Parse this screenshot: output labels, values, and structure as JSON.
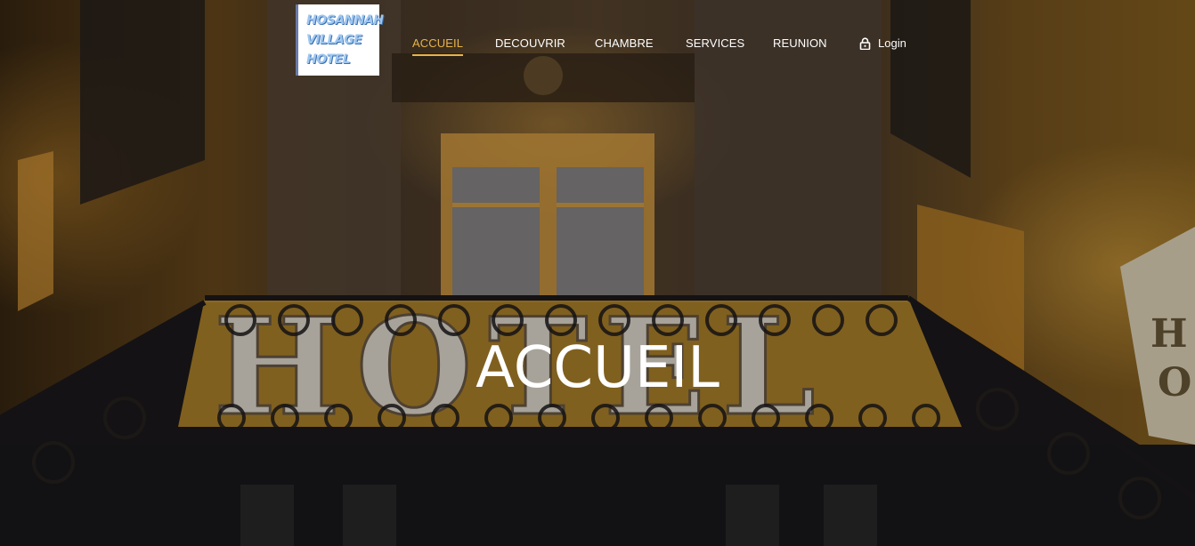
{
  "logo": {
    "lines": [
      "HOSANNAH",
      "VILLAGE",
      "HOTEL"
    ]
  },
  "nav": {
    "items": [
      {
        "label": "ACCUEIL",
        "active": true
      },
      {
        "label": "DECOUVRIR",
        "active": false
      },
      {
        "label": "CHAMBRE",
        "active": false
      },
      {
        "label": "SERVICES",
        "active": false
      },
      {
        "label": "REUNION",
        "active": false
      }
    ],
    "login_label": "Login",
    "login_icon": "lock-icon"
  },
  "hero": {
    "title": "ACCUEIL",
    "background_image": "hotel-facade-photo"
  },
  "colors": {
    "accent": "#e8b34a",
    "text": "#ffffff",
    "logo_text": "#9ec7f0"
  }
}
